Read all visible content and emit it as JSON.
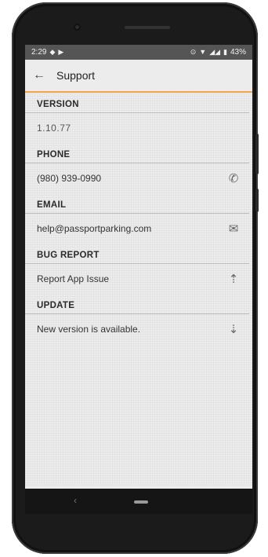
{
  "status": {
    "time": "2:29",
    "battery": "43%"
  },
  "appbar": {
    "title": "Support"
  },
  "sections": {
    "version": {
      "header": "VERSION",
      "value": "1.10.77"
    },
    "phone": {
      "header": "PHONE",
      "value": "(980) 939-0990",
      "icon": "phone-icon"
    },
    "email": {
      "header": "EMAIL",
      "value": "help@passportparking.com",
      "icon": "email-add-icon"
    },
    "bug": {
      "header": "BUG REPORT",
      "value": "Report App Issue",
      "icon": "upload-icon"
    },
    "update": {
      "header": "UPDATE",
      "value": "New version is available.",
      "icon": "download-icon"
    }
  },
  "colors": {
    "accent": "#f5a24a",
    "statusbar": "#555555",
    "background": "#ececec"
  }
}
